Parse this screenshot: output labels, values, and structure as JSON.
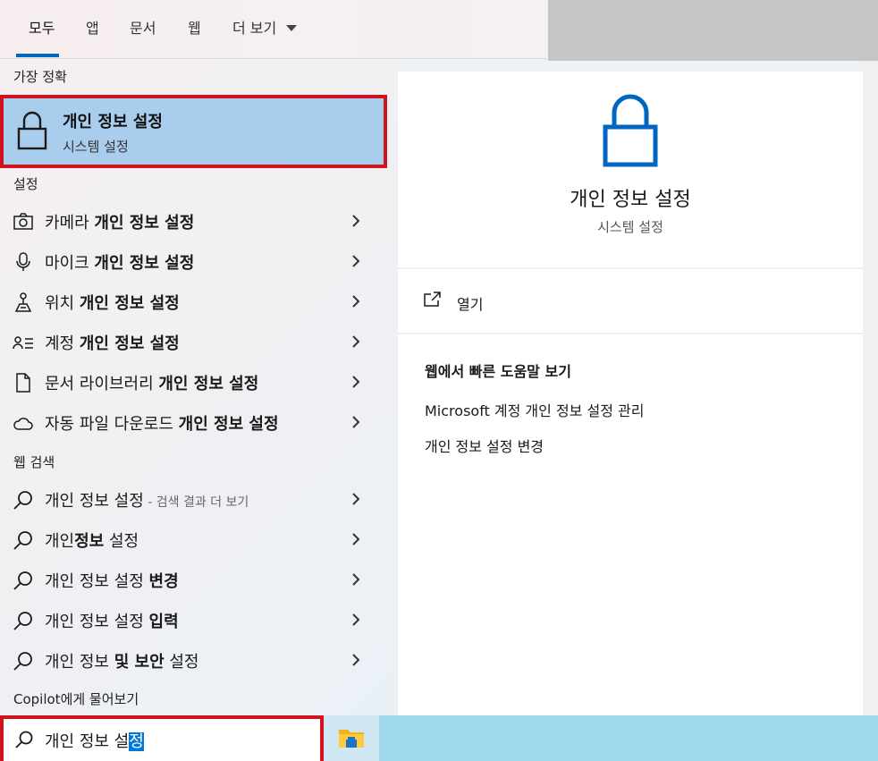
{
  "tabs": {
    "all": "모두",
    "apps": "앱",
    "documents": "문서",
    "web": "웹",
    "more": "더 보기"
  },
  "sections": {
    "best_match": "가장 정확",
    "settings": "설정",
    "web_search": "웹 검색",
    "copilot": "Copilot에게 물어보기"
  },
  "best_match": {
    "title": "개인 정보 설정",
    "subtitle": "시스템 설정"
  },
  "settings_items": [
    {
      "icon": "camera-icon",
      "prefix": "카메라 ",
      "bold": "개인 정보 설정"
    },
    {
      "icon": "microphone-icon",
      "prefix": "마이크 ",
      "bold": "개인 정보 설정"
    },
    {
      "icon": "location-icon",
      "prefix": "위치 ",
      "bold": "개인 정보 설정"
    },
    {
      "icon": "account-icon",
      "prefix": "계정 ",
      "bold": "개인 정보 설정"
    },
    {
      "icon": "document-icon",
      "prefix": "문서 라이브러리 ",
      "bold": "개인 정보 설정"
    },
    {
      "icon": "cloud-icon",
      "prefix": "자동 파일 다운로드 ",
      "bold": "개인 정보 설정"
    }
  ],
  "web_items": [
    {
      "pre": "개인 정보 설정",
      "bold": "",
      "post": "",
      "suffix": " - 검색 결과 더 보기"
    },
    {
      "pre": "개인",
      "bold": "정보",
      "post": " 설정",
      "suffix": ""
    },
    {
      "pre": "개인 정보 설정 ",
      "bold": "변경",
      "post": "",
      "suffix": ""
    },
    {
      "pre": "개인 정보 설정 ",
      "bold": "입력",
      "post": "",
      "suffix": ""
    },
    {
      "pre": "개인 정보 ",
      "bold": "및 보안",
      "post": " 설정",
      "suffix": ""
    }
  ],
  "detail": {
    "title": "개인 정보 설정",
    "subtitle": "시스템 설정",
    "open_label": "열기",
    "help_title": "웹에서 빠른 도움말 보기",
    "help_links": [
      "Microsoft 계정 개인 정보 설정 관리",
      "개인 정보 설정 변경"
    ]
  },
  "search": {
    "value_unselected": "개인 정보 설",
    "value_selected": "정"
  },
  "colors": {
    "accent": "#0067c0",
    "highlight": "#a9cdec",
    "annotation_red": "#d1121f",
    "taskbar": "#9fd8ea"
  }
}
